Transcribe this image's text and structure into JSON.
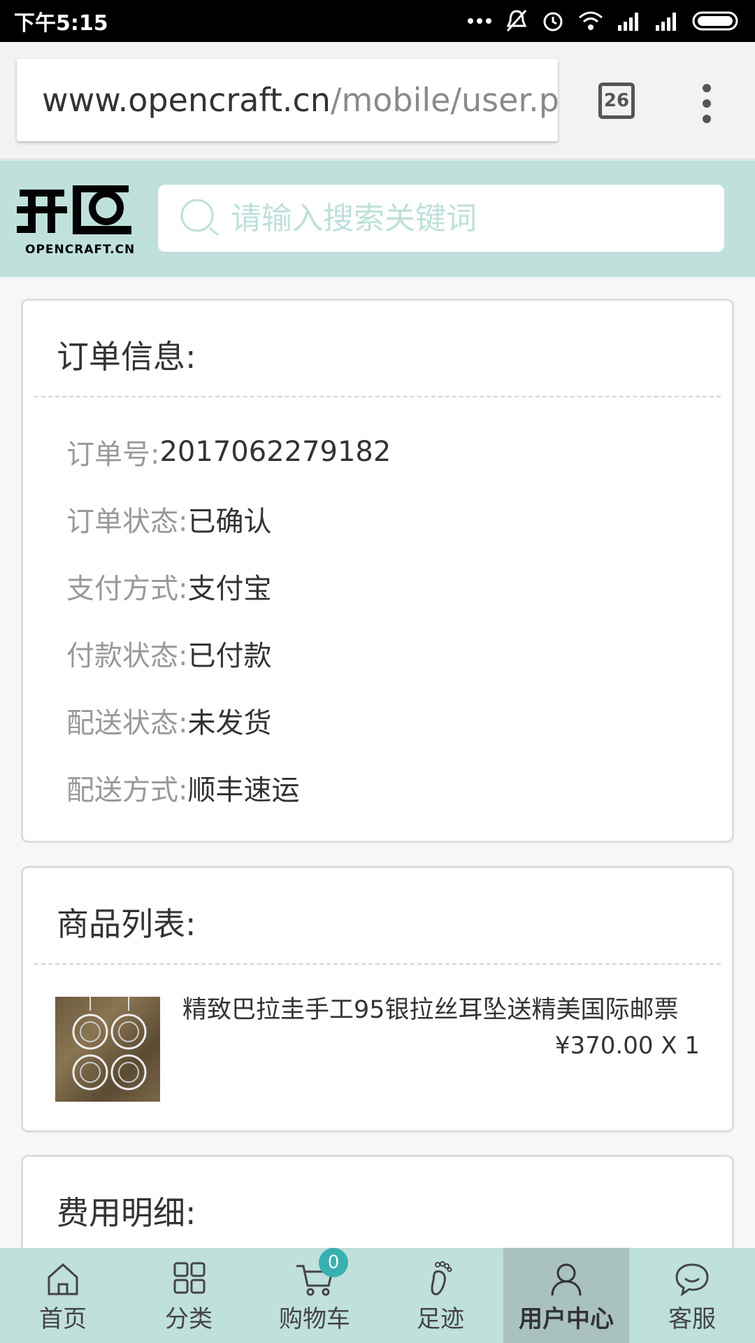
{
  "status_bar": {
    "time": "下午5:15"
  },
  "browser": {
    "url_domain": "www.opencraft.cn",
    "url_path": "/mobile/user.ph",
    "tab_count": "26"
  },
  "header": {
    "logo_text": "OPENCRAFT.CN",
    "search_placeholder": "请输入搜索关键词"
  },
  "order_info": {
    "title": "订单信息:",
    "rows": [
      {
        "label": "订单号:",
        "value": "2017062279182"
      },
      {
        "label": "订单状态:",
        "value": "已确认"
      },
      {
        "label": "支付方式:",
        "value": "支付宝"
      },
      {
        "label": "付款状态:",
        "value": "已付款"
      },
      {
        "label": "配送状态:",
        "value": "未发货"
      },
      {
        "label": "配送方式:",
        "value": "顺丰速运"
      }
    ]
  },
  "product_list": {
    "title": "商品列表:",
    "items": [
      {
        "name": "精致巴拉圭手工95银拉丝耳坠送精美国际邮票",
        "price": "¥370.00 X 1"
      }
    ]
  },
  "fee_details": {
    "title": "费用明细:"
  },
  "bottom_nav": {
    "items": [
      {
        "label": "首页",
        "icon": "home-icon"
      },
      {
        "label": "分类",
        "icon": "grid-icon"
      },
      {
        "label": "购物车",
        "icon": "cart-icon",
        "badge": "0"
      },
      {
        "label": "足迹",
        "icon": "footprint-icon"
      },
      {
        "label": "用户中心",
        "icon": "user-icon",
        "active": true
      },
      {
        "label": "客服",
        "icon": "chat-icon"
      }
    ]
  },
  "colors": {
    "header_bg": "#bfe0db",
    "nav_active_bg": "#a9c2bf",
    "badge": "#39b0b0"
  }
}
